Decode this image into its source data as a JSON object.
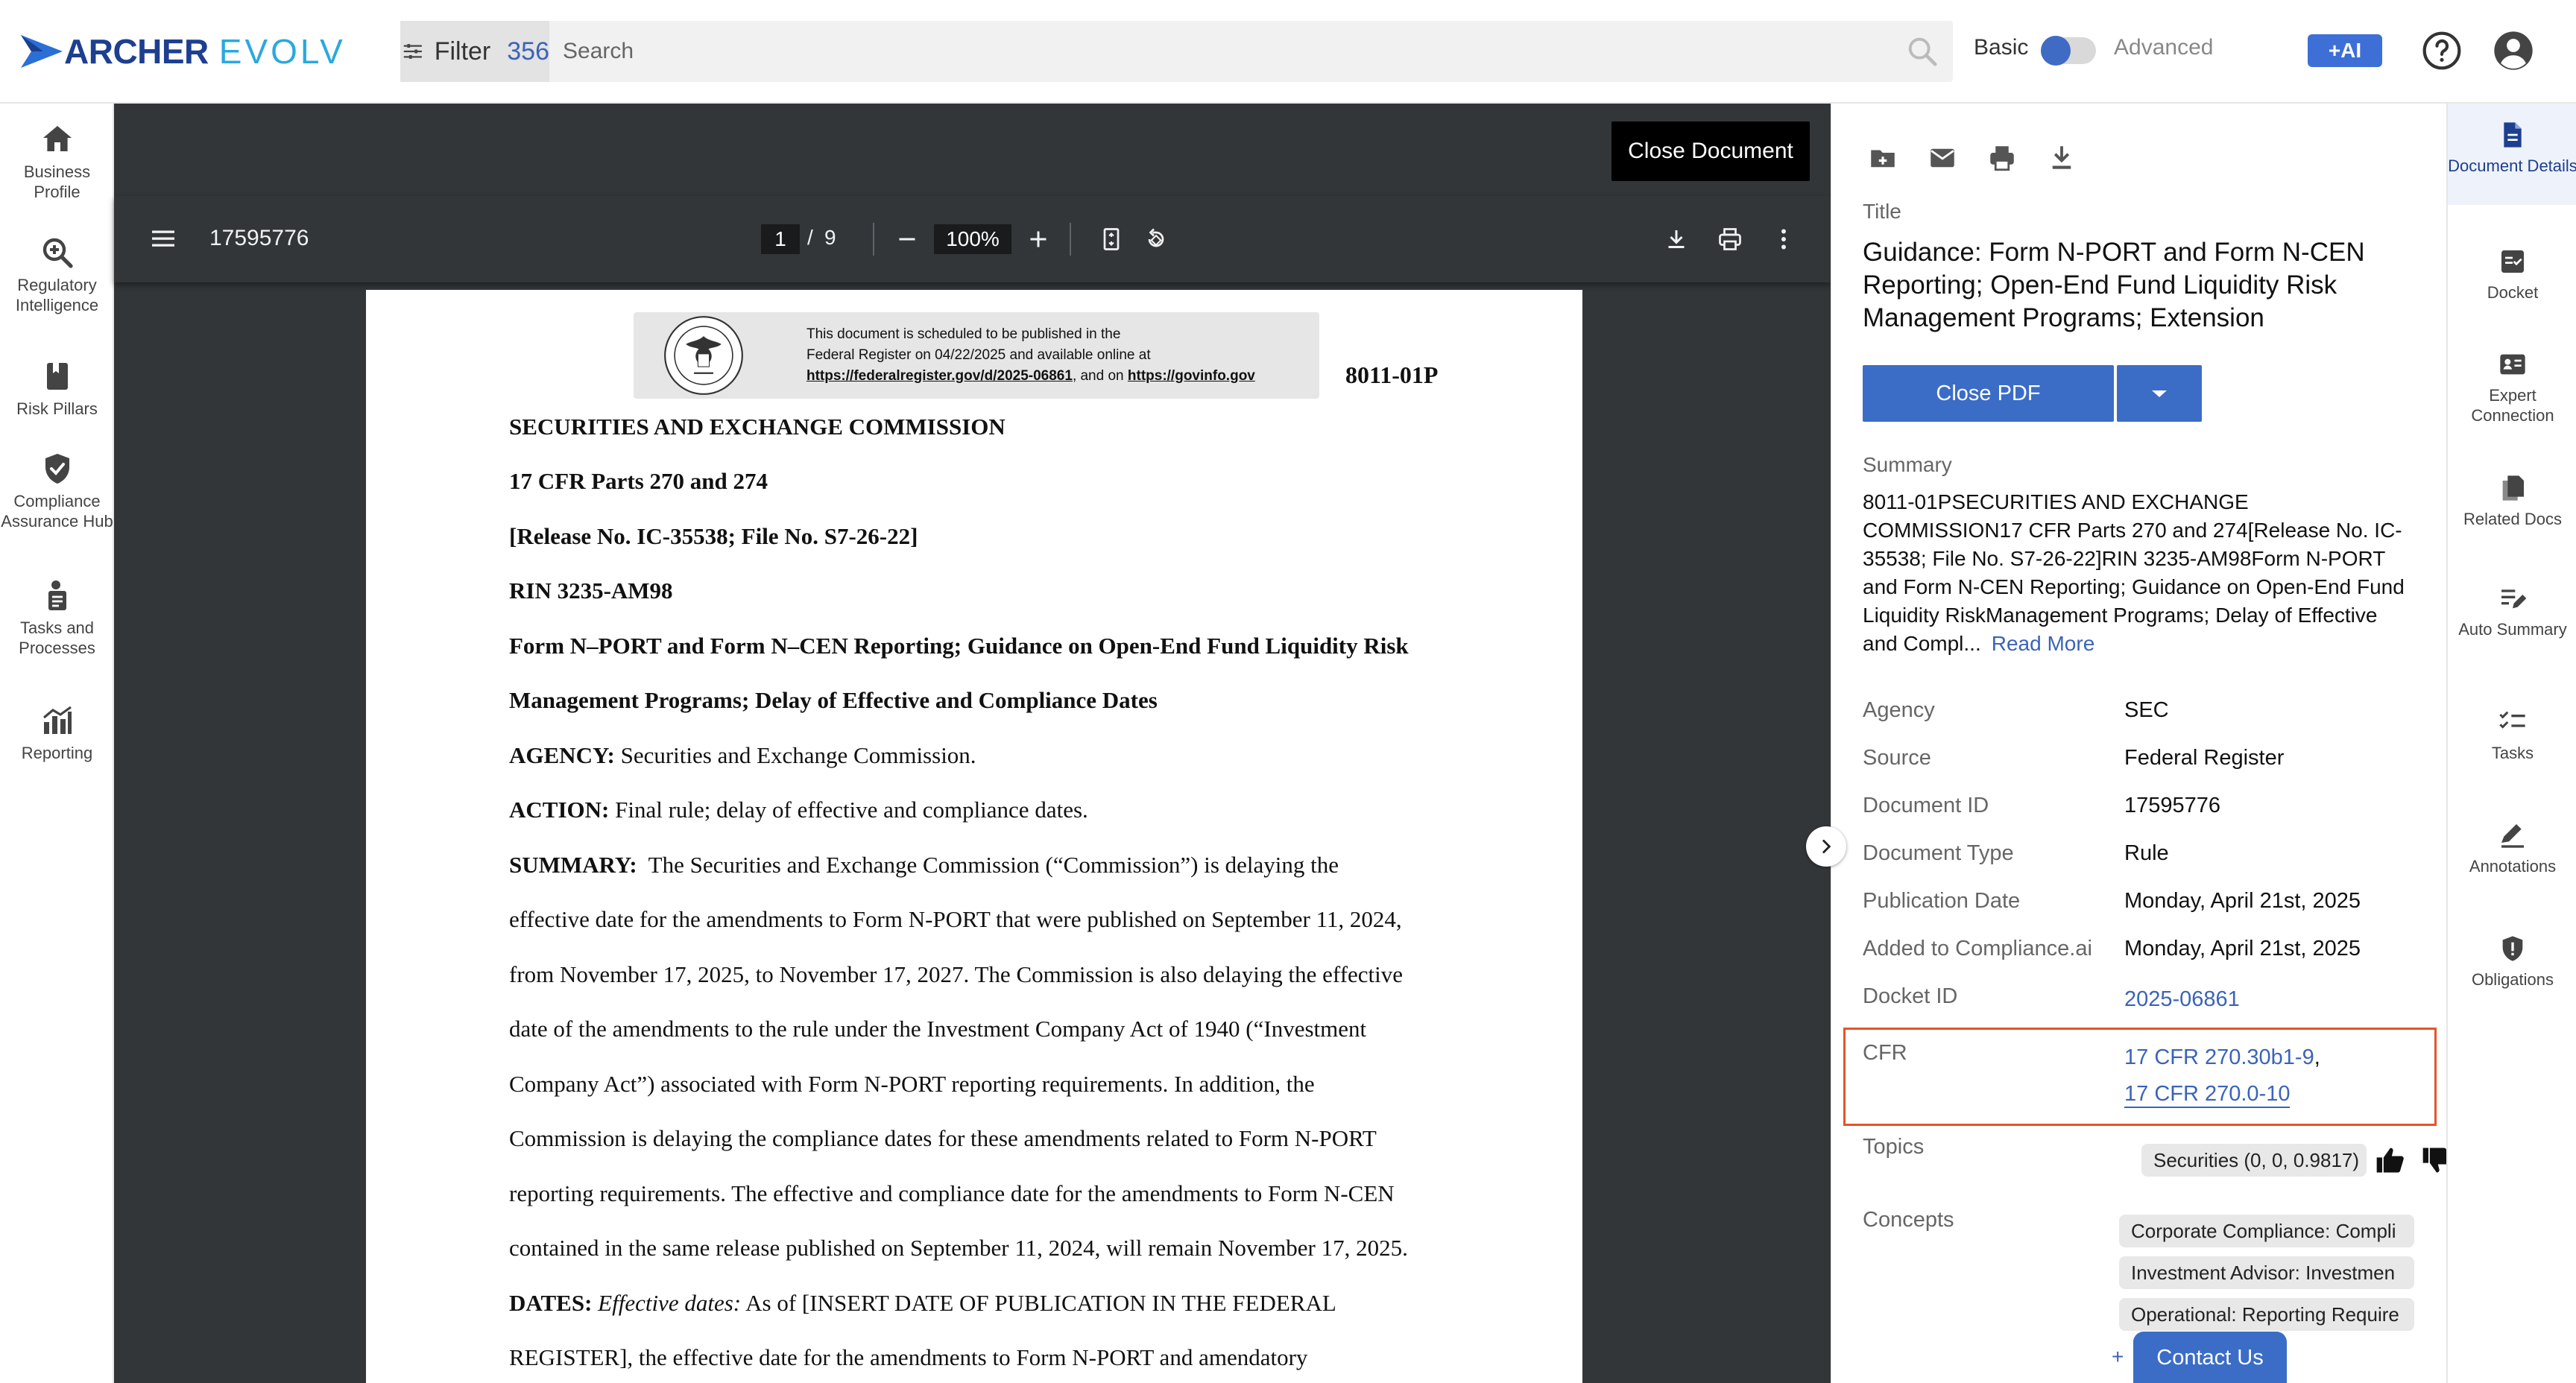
{
  "brand": {
    "archer": "ARCHER",
    "evolv": "EVOLV"
  },
  "topbar": {
    "filter_label": "Filter",
    "filter_count": "356",
    "search_placeholder": "Search",
    "mode_basic": "Basic",
    "mode_advanced": "Advanced",
    "ai_label": "+AI"
  },
  "left_nav": [
    {
      "label": "Business Profile",
      "icon": "home-icon"
    },
    {
      "label": "Regulatory Intelligence",
      "icon": "magnify-plus-icon"
    },
    {
      "label": "Risk Pillars",
      "icon": "bookmark-icon"
    },
    {
      "label": "Compliance Assurance Hub",
      "icon": "shield-check-icon"
    },
    {
      "label": "Tasks and Processes",
      "icon": "user-task-icon"
    },
    {
      "label": "Reporting",
      "icon": "chart-icon"
    }
  ],
  "pdf": {
    "close_document": "Close Document",
    "doc_number": "17595776",
    "page_current": "1",
    "page_sep": "/",
    "page_total": "9",
    "zoom": "100%",
    "stamp": {
      "line1": "This document is scheduled to be published in the",
      "line2": "Federal Register on 04/22/2025 and available online at",
      "link1": "https://federalregister.gov/d/2025-06861",
      "and_on": ", and on ",
      "link2": "https://govinfo.gov"
    },
    "code": "8011-01P",
    "lines": [
      "SECURITIES AND EXCHANGE COMMISSION",
      "17 CFR Parts 270 and 274",
      "[Release No. IC-35538; File No. S7-26-22]",
      "RIN 3235-AM98",
      "Form N–PORT and Form N–CEN Reporting; Guidance on Open-End Fund Liquidity Risk",
      "Management Programs; Delay of Effective and Compliance Dates"
    ],
    "agency_label": "AGENCY:",
    "agency_text": " Securities and Exchange Commission.",
    "action_label": "ACTION:",
    "action_text": " Final rule; delay of effective and compliance dates.",
    "summary_label": "SUMMARY:",
    "summary_lines": [
      "  The Securities and Exchange Commission (“Commission”) is delaying the",
      "effective date for the amendments to Form N-PORT that were published on September 11, 2024,",
      "from November 17, 2025, to November 17, 2027. The Commission is also delaying the effective",
      "date of the amendments to the rule under the Investment Company Act of 1940 (“Investment",
      "Company Act”) associated with Form N-PORT reporting requirements. In addition, the",
      "Commission is delaying the compliance dates for these amendments related to Form N-PORT",
      "reporting requirements. The effective and compliance date for the amendments to Form N-CEN",
      "contained in the same release published on September 11, 2024, will remain November 17, 2025."
    ],
    "dates_label": "DATES:",
    "dates_italic": " Effective dates:",
    "dates_text": " As of [INSERT DATE OF PUBLICATION IN THE FEDERAL",
    "last_line": "REGISTER], the effective date for the amendments to Form N-PORT and amendatory"
  },
  "details": {
    "title_label": "Title",
    "title": "Guidance: Form N-PORT and Form N-CEN Reporting; Open-End Fund Liquidity Risk Management Programs; Extension",
    "close_pdf": "Close PDF",
    "summary_label": "Summary",
    "summary": "8011-01PSECURITIES AND EXCHANGE COMMISSION17 CFR Parts 270 and 274[Release No. IC-35538; File No. S7-26-22]RIN 3235-AM98Form N-PORT and Form N-CEN Reporting; Guidance on Open-End Fund Liquidity RiskManagement Programs; Delay of Effective and Compl...",
    "read_more": "Read More",
    "meta": [
      {
        "key": "Agency",
        "value": "SEC"
      },
      {
        "key": "Source",
        "value": "Federal Register"
      },
      {
        "key": "Document ID",
        "value": "17595776"
      },
      {
        "key": "Document Type",
        "value": "Rule"
      },
      {
        "key": "Publication Date",
        "value": "Monday, April 21st, 2025"
      },
      {
        "key": "Added to Compliance.ai",
        "value": "Monday, April 21st, 2025"
      }
    ],
    "docket_key": "Docket ID",
    "docket_value": "2025-06861",
    "cfr_key": "CFR",
    "cfr_1": "17 CFR 270.30b1-9",
    "cfr_comma": ",",
    "cfr_2": "17 CFR 270.0-10",
    "topics_key": "Topics",
    "topic_chip": "Securities (0, 0, 0.9817)",
    "concepts_key": "Concepts",
    "concepts": [
      "Corporate Compliance: Compli",
      "Investment Advisor: Investmen",
      "Operational: Reporting Require"
    ],
    "contact_us": "Contact Us"
  },
  "rail": [
    {
      "label": "Document Details",
      "icon": "document-icon",
      "active": true
    },
    {
      "label": "Docket",
      "icon": "docket-icon"
    },
    {
      "label": "Expert Connection",
      "icon": "id-card-icon"
    },
    {
      "label": "Related Docs",
      "icon": "copy-icon"
    },
    {
      "label": "Auto Summary",
      "icon": "edit-lines-icon"
    },
    {
      "label": "Tasks",
      "icon": "checklist-icon"
    },
    {
      "label": "Annotations",
      "icon": "pencil-icon"
    },
    {
      "label": "Obligations",
      "icon": "shield-alert-icon"
    }
  ]
}
